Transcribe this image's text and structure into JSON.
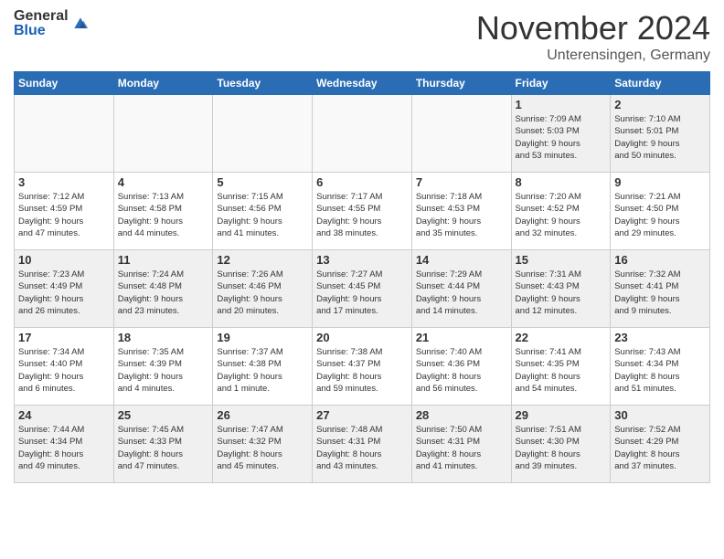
{
  "logo": {
    "general": "General",
    "blue": "Blue"
  },
  "title": "November 2024",
  "location": "Unterensingen, Germany",
  "days_header": [
    "Sunday",
    "Monday",
    "Tuesday",
    "Wednesday",
    "Thursday",
    "Friday",
    "Saturday"
  ],
  "weeks": [
    [
      {
        "num": "",
        "info": ""
      },
      {
        "num": "",
        "info": ""
      },
      {
        "num": "",
        "info": ""
      },
      {
        "num": "",
        "info": ""
      },
      {
        "num": "",
        "info": ""
      },
      {
        "num": "1",
        "info": "Sunrise: 7:09 AM\nSunset: 5:03 PM\nDaylight: 9 hours\nand 53 minutes."
      },
      {
        "num": "2",
        "info": "Sunrise: 7:10 AM\nSunset: 5:01 PM\nDaylight: 9 hours\nand 50 minutes."
      }
    ],
    [
      {
        "num": "3",
        "info": "Sunrise: 7:12 AM\nSunset: 4:59 PM\nDaylight: 9 hours\nand 47 minutes."
      },
      {
        "num": "4",
        "info": "Sunrise: 7:13 AM\nSunset: 4:58 PM\nDaylight: 9 hours\nand 44 minutes."
      },
      {
        "num": "5",
        "info": "Sunrise: 7:15 AM\nSunset: 4:56 PM\nDaylight: 9 hours\nand 41 minutes."
      },
      {
        "num": "6",
        "info": "Sunrise: 7:17 AM\nSunset: 4:55 PM\nDaylight: 9 hours\nand 38 minutes."
      },
      {
        "num": "7",
        "info": "Sunrise: 7:18 AM\nSunset: 4:53 PM\nDaylight: 9 hours\nand 35 minutes."
      },
      {
        "num": "8",
        "info": "Sunrise: 7:20 AM\nSunset: 4:52 PM\nDaylight: 9 hours\nand 32 minutes."
      },
      {
        "num": "9",
        "info": "Sunrise: 7:21 AM\nSunset: 4:50 PM\nDaylight: 9 hours\nand 29 minutes."
      }
    ],
    [
      {
        "num": "10",
        "info": "Sunrise: 7:23 AM\nSunset: 4:49 PM\nDaylight: 9 hours\nand 26 minutes."
      },
      {
        "num": "11",
        "info": "Sunrise: 7:24 AM\nSunset: 4:48 PM\nDaylight: 9 hours\nand 23 minutes."
      },
      {
        "num": "12",
        "info": "Sunrise: 7:26 AM\nSunset: 4:46 PM\nDaylight: 9 hours\nand 20 minutes."
      },
      {
        "num": "13",
        "info": "Sunrise: 7:27 AM\nSunset: 4:45 PM\nDaylight: 9 hours\nand 17 minutes."
      },
      {
        "num": "14",
        "info": "Sunrise: 7:29 AM\nSunset: 4:44 PM\nDaylight: 9 hours\nand 14 minutes."
      },
      {
        "num": "15",
        "info": "Sunrise: 7:31 AM\nSunset: 4:43 PM\nDaylight: 9 hours\nand 12 minutes."
      },
      {
        "num": "16",
        "info": "Sunrise: 7:32 AM\nSunset: 4:41 PM\nDaylight: 9 hours\nand 9 minutes."
      }
    ],
    [
      {
        "num": "17",
        "info": "Sunrise: 7:34 AM\nSunset: 4:40 PM\nDaylight: 9 hours\nand 6 minutes."
      },
      {
        "num": "18",
        "info": "Sunrise: 7:35 AM\nSunset: 4:39 PM\nDaylight: 9 hours\nand 4 minutes."
      },
      {
        "num": "19",
        "info": "Sunrise: 7:37 AM\nSunset: 4:38 PM\nDaylight: 9 hours\nand 1 minute."
      },
      {
        "num": "20",
        "info": "Sunrise: 7:38 AM\nSunset: 4:37 PM\nDaylight: 8 hours\nand 59 minutes."
      },
      {
        "num": "21",
        "info": "Sunrise: 7:40 AM\nSunset: 4:36 PM\nDaylight: 8 hours\nand 56 minutes."
      },
      {
        "num": "22",
        "info": "Sunrise: 7:41 AM\nSunset: 4:35 PM\nDaylight: 8 hours\nand 54 minutes."
      },
      {
        "num": "23",
        "info": "Sunrise: 7:43 AM\nSunset: 4:34 PM\nDaylight: 8 hours\nand 51 minutes."
      }
    ],
    [
      {
        "num": "24",
        "info": "Sunrise: 7:44 AM\nSunset: 4:34 PM\nDaylight: 8 hours\nand 49 minutes."
      },
      {
        "num": "25",
        "info": "Sunrise: 7:45 AM\nSunset: 4:33 PM\nDaylight: 8 hours\nand 47 minutes."
      },
      {
        "num": "26",
        "info": "Sunrise: 7:47 AM\nSunset: 4:32 PM\nDaylight: 8 hours\nand 45 minutes."
      },
      {
        "num": "27",
        "info": "Sunrise: 7:48 AM\nSunset: 4:31 PM\nDaylight: 8 hours\nand 43 minutes."
      },
      {
        "num": "28",
        "info": "Sunrise: 7:50 AM\nSunset: 4:31 PM\nDaylight: 8 hours\nand 41 minutes."
      },
      {
        "num": "29",
        "info": "Sunrise: 7:51 AM\nSunset: 4:30 PM\nDaylight: 8 hours\nand 39 minutes."
      },
      {
        "num": "30",
        "info": "Sunrise: 7:52 AM\nSunset: 4:29 PM\nDaylight: 8 hours\nand 37 minutes."
      }
    ]
  ]
}
